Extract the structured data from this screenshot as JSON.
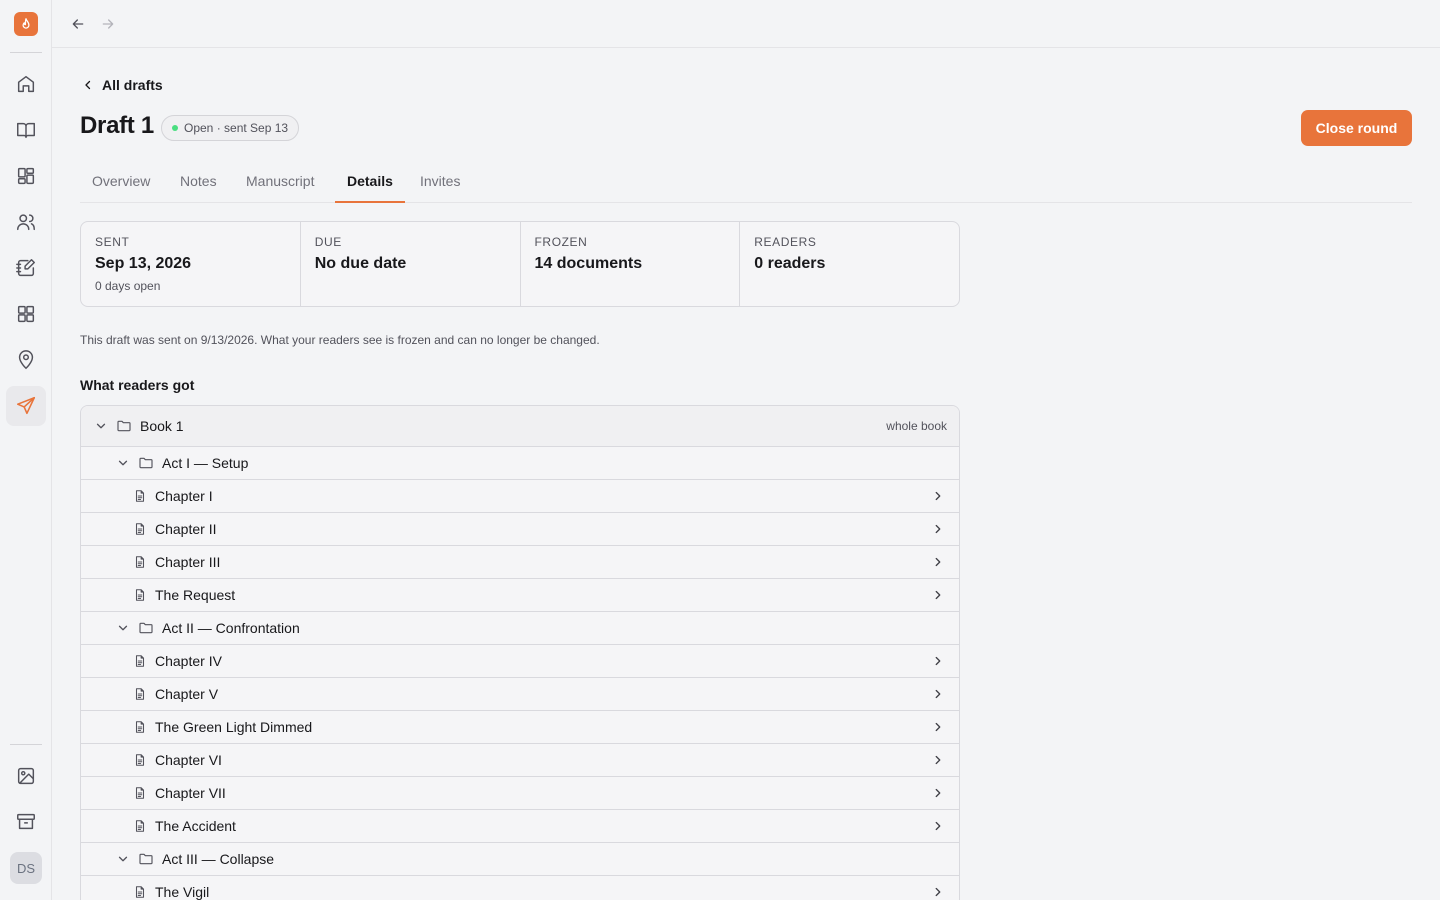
{
  "sidebar": {
    "items": [
      {
        "name": "home",
        "icon": "home-icon"
      },
      {
        "name": "books",
        "icon": "book-open-icon"
      },
      {
        "name": "boards",
        "icon": "grid-icon"
      },
      {
        "name": "people",
        "icon": "users-icon"
      },
      {
        "name": "notebook",
        "icon": "notebook-pen-icon"
      },
      {
        "name": "apps",
        "icon": "grid-icon"
      },
      {
        "name": "places",
        "icon": "map-pin-icon"
      },
      {
        "name": "drafts",
        "icon": "send-icon",
        "active": true
      },
      {
        "name": "images",
        "icon": "image-icon"
      },
      {
        "name": "archive",
        "icon": "archive-icon"
      }
    ],
    "avatar": "DS",
    "accent": "#e8743b"
  },
  "header": {
    "back_label": "All drafts",
    "title": "Draft 1",
    "status": "Open · sent Sep 13",
    "close_label": "Close round"
  },
  "tabs": [
    {
      "label": "Overview"
    },
    {
      "label": "Notes"
    },
    {
      "label": "Manuscript"
    },
    {
      "label": "Details",
      "active": true
    },
    {
      "label": "Invites"
    }
  ],
  "stats": [
    {
      "label": "Sent",
      "value": "Sep 13, 2026",
      "sub": "0 days open"
    },
    {
      "label": "Due",
      "value": "No due date",
      "sub": ""
    },
    {
      "label": "Frozen",
      "value": "14 documents",
      "sub": ""
    },
    {
      "label": "Readers",
      "value": "0 readers",
      "sub": ""
    }
  ],
  "note": "This draft was sent on 9/13/2026. What your readers see is frozen and can no longer be changed.",
  "section_title": "What readers got",
  "tree": {
    "book": {
      "label": "Book 1",
      "scope": "whole book"
    },
    "rows": [
      {
        "type": "folder",
        "label": "Act I — Setup"
      },
      {
        "type": "doc",
        "label": "Chapter I"
      },
      {
        "type": "doc",
        "label": "Chapter II"
      },
      {
        "type": "doc",
        "label": "Chapter III"
      },
      {
        "type": "doc",
        "label": "The Request"
      },
      {
        "type": "folder",
        "label": "Act II — Confrontation"
      },
      {
        "type": "doc",
        "label": "Chapter IV"
      },
      {
        "type": "doc",
        "label": "Chapter V"
      },
      {
        "type": "doc",
        "label": "The Green Light Dimmed"
      },
      {
        "type": "doc",
        "label": "Chapter VI"
      },
      {
        "type": "doc",
        "label": "Chapter VII"
      },
      {
        "type": "doc",
        "label": "The Accident"
      },
      {
        "type": "folder",
        "label": "Act III — Collapse"
      },
      {
        "type": "doc",
        "label": "The Vigil"
      }
    ]
  }
}
